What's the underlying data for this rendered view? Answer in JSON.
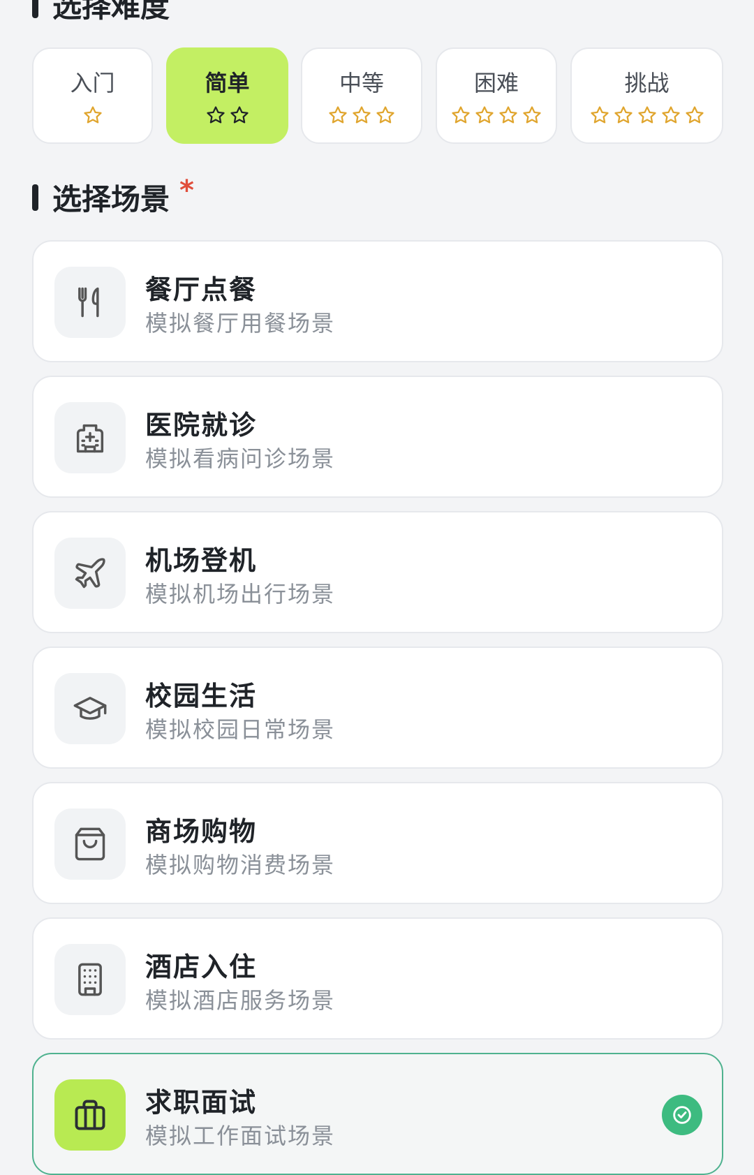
{
  "difficulty": {
    "title": "选择难度",
    "required_mark": "*",
    "options": [
      {
        "label": "入门",
        "stars": 1,
        "selected": false
      },
      {
        "label": "简单",
        "stars": 2,
        "selected": true
      },
      {
        "label": "中等",
        "stars": 3,
        "selected": false
      },
      {
        "label": "困难",
        "stars": 4,
        "selected": false
      },
      {
        "label": "挑战",
        "stars": 5,
        "selected": false
      }
    ]
  },
  "scene": {
    "title": "选择场景",
    "required_mark": "*",
    "items": [
      {
        "title": "餐厅点餐",
        "desc": "模拟餐厅用餐场景",
        "icon": "utensils-icon",
        "selected": false
      },
      {
        "title": "医院就诊",
        "desc": "模拟看病问诊场景",
        "icon": "hospital-icon",
        "selected": false
      },
      {
        "title": "机场登机",
        "desc": "模拟机场出行场景",
        "icon": "plane-icon",
        "selected": false
      },
      {
        "title": "校园生活",
        "desc": "模拟校园日常场景",
        "icon": "graduation-cap-icon",
        "selected": false
      },
      {
        "title": "商场购物",
        "desc": "模拟购物消费场景",
        "icon": "shopping-bag-icon",
        "selected": false
      },
      {
        "title": "酒店入住",
        "desc": "模拟酒店服务场景",
        "icon": "building-icon",
        "selected": false
      },
      {
        "title": "求职面试",
        "desc": "模拟工作面试场景",
        "icon": "briefcase-icon",
        "selected": true
      }
    ]
  },
  "colors": {
    "accent": "#c3ef63",
    "check": "#3dbb80",
    "required": "#e04d3b",
    "star": "#e0a52e"
  }
}
